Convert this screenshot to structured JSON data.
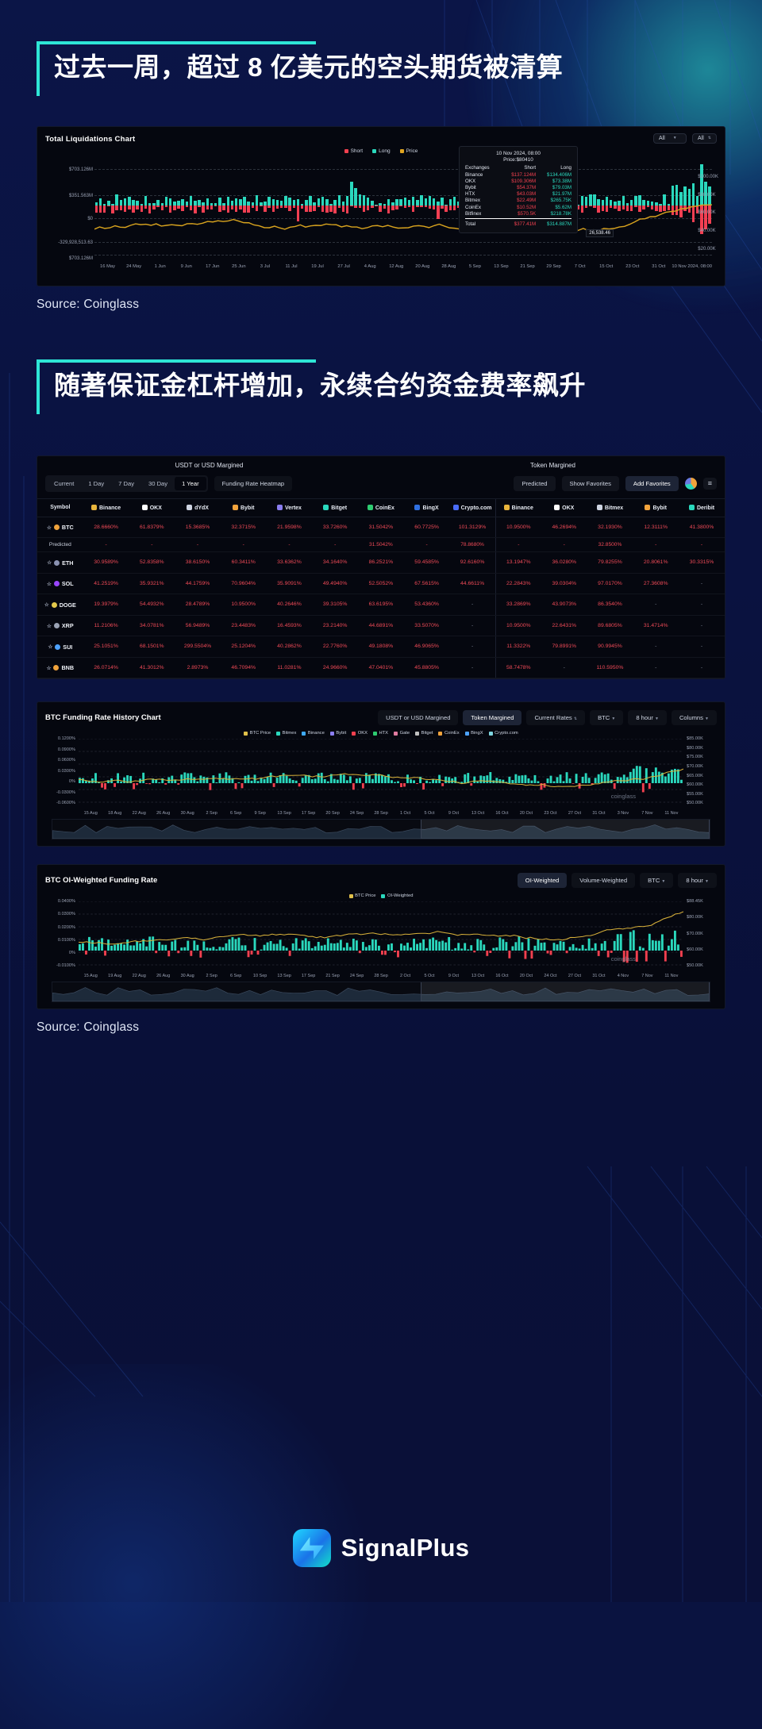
{
  "headline1": "过去一周，超过 8 亿美元的空头期货被清算",
  "headline2": "随著保证金杠杆增加，永续合约资金费率飙升",
  "source1": "Source: Coinglass",
  "source2": "Source: Coinglass",
  "brand": "SignalPlus",
  "liquidations": {
    "title": "Total Liquidations Chart",
    "controls": [
      {
        "label": "All"
      },
      {
        "label": "All"
      }
    ],
    "legend": [
      {
        "label": "Short",
        "color": "#f2404f"
      },
      {
        "label": "Long",
        "color": "#2ad8bd"
      },
      {
        "label": "Price",
        "color": "#e0a420"
      }
    ],
    "y_labels": [
      "$703.126M",
      "$351.563M",
      "$0",
      "-329,928,513.63",
      "$703.126M"
    ],
    "y_right": [
      "$100.00K",
      "$80.00K",
      "$60.00K",
      "$40.00K",
      "$20.00K"
    ],
    "x_labels": [
      "16 May",
      "24 May",
      "1 Jun",
      "9 Jun",
      "17 Jun",
      "25 Jun",
      "3 Jul",
      "11 Jul",
      "19 Jul",
      "27 Jul",
      "4 Aug",
      "12 Aug",
      "20 Aug",
      "28 Aug",
      "5 Sep",
      "13 Sep",
      "21 Sep",
      "29 Sep",
      "7 Oct",
      "15 Oct",
      "23 Oct",
      "31 Oct",
      "10 Nov 2024, 08:00"
    ],
    "tooltip": {
      "date": "10 Nov 2024, 08:00",
      "price": "Price:$80410",
      "headers": [
        "Exchanges",
        "Short",
        "Long"
      ],
      "rows": [
        {
          "exchange": "Binance",
          "short": "$137.124M",
          "long": "$134.406M"
        },
        {
          "exchange": "OKX",
          "short": "$109.306M",
          "long": "$73.38M"
        },
        {
          "exchange": "Bybit",
          "short": "$54.37M",
          "long": "$79.03M"
        },
        {
          "exchange": "HTX",
          "short": "$43.03M",
          "long": "$21.97M"
        },
        {
          "exchange": "Bitmex",
          "short": "$22.49M",
          "long": "$265.75K"
        },
        {
          "exchange": "CoinEx",
          "short": "$10.52M",
          "long": "$5.62M"
        },
        {
          "exchange": "Bitfinex",
          "short": "$570.5K",
          "long": "$218.78K"
        }
      ],
      "total": {
        "exchange": "Total",
        "short": "$377.41M",
        "long": "$314.887M"
      },
      "marker": "26,538.46"
    }
  },
  "heatmap": {
    "group_left": "USDT or USD Margined",
    "group_right": "Token Margined",
    "tabs": [
      "Current",
      "1 Day",
      "7 Day",
      "30 Day",
      "1 Year"
    ],
    "tab_active": "1 Year",
    "heatmap_button": "Funding Rate Heatmap",
    "predicted_button": "Predicted",
    "favorites_button": "Show Favorites",
    "add_favorites_button": "Add Favorites",
    "columns": [
      "Symbol",
      "Binance",
      "OKX",
      "dYdX",
      "Bybit",
      "Vertex",
      "Bitget",
      "CoinEx",
      "BingX",
      "Crypto.com",
      "Binance",
      "OKX",
      "Bitmex",
      "Bybit",
      "Deribit"
    ],
    "rows": [
      {
        "symbol": "BTC",
        "color": "#f0a33c",
        "values": [
          "28.6660%",
          "61.8379%",
          "15.3685%",
          "32.3715%",
          "21.9598%",
          "33.7260%",
          "31.5042%",
          "60.7725%",
          "101.3129%",
          "10.9500%",
          "46.2694%",
          "32.1930%",
          "12.3111%",
          "41.3800%"
        ]
      },
      {
        "symbol": "Predicted",
        "predicted": true,
        "values": [
          "-",
          "-",
          "-",
          "-",
          "-",
          "-",
          "31.5042%",
          "-",
          "78.8680%",
          "-",
          "-",
          "32.8500%",
          "-",
          "-"
        ]
      },
      {
        "symbol": "ETH",
        "color": "#8a92b2",
        "values": [
          "30.9589%",
          "52.8358%",
          "38.6150%",
          "60.3411%",
          "33.6362%",
          "34.1640%",
          "86.2521%",
          "59.4585%",
          "92.6160%",
          "13.1947%",
          "36.0280%",
          "79.8255%",
          "20.8061%",
          "30.3315%"
        ]
      },
      {
        "symbol": "SOL",
        "color": "#9945ff",
        "values": [
          "41.2519%",
          "35.9321%",
          "44.1759%",
          "70.9604%",
          "35.9091%",
          "49.4940%",
          "52.5052%",
          "67.5615%",
          "44.6611%",
          "22.2843%",
          "39.0304%",
          "97.0170%",
          "27.3608%",
          "-"
        ]
      },
      {
        "symbol": "DOGE",
        "color": "#e2c84b",
        "values": [
          "19.3979%",
          "54.4932%",
          "28.4789%",
          "10.9500%",
          "40.2646%",
          "39.3105%",
          "63.6195%",
          "53.4360%",
          "-",
          "33.2869%",
          "43.9073%",
          "86.3540%",
          "-",
          "-"
        ]
      },
      {
        "symbol": "XRP",
        "color": "#9aa2b4",
        "values": [
          "11.2106%",
          "34.0781%",
          "56.9489%",
          "23.4483%",
          "16.4593%",
          "23.2140%",
          "44.6891%",
          "33.5070%",
          "-",
          "10.9500%",
          "22.6431%",
          "89.6805%",
          "31.4714%",
          "-"
        ]
      },
      {
        "symbol": "SUI",
        "color": "#4da2ff",
        "values": [
          "25.1051%",
          "68.1501%",
          "299.5504%",
          "25.1204%",
          "40.2862%",
          "22.7760%",
          "49.1808%",
          "46.9065%",
          "-",
          "11.3322%",
          "79.8991%",
          "90.9945%",
          "-",
          "-"
        ]
      },
      {
        "symbol": "BNB",
        "color": "#f0a33c",
        "values": [
          "26.0714%",
          "41.3012%",
          "2.8973%",
          "46.7094%",
          "11.0281%",
          "24.9660%",
          "47.0401%",
          "45.8805%",
          "-",
          "58.7478%",
          "-",
          "110.5950%",
          "-",
          "-"
        ]
      }
    ]
  },
  "funding_chart": {
    "title": "BTC Funding Rate History Chart",
    "buttons": [
      "USDT or USD Margined",
      "Token Margined",
      "Current Rates",
      "BTC",
      "8 hour",
      "Columns"
    ],
    "active_button": "Token Margined",
    "legend": [
      "BTC Price",
      "Bitmex",
      "Binance",
      "Bybit",
      "OKX",
      "HTX",
      "Gate",
      "Bitget",
      "CoinEx",
      "BingX",
      "Crypto.com"
    ],
    "legend_colors": [
      "#e0c04a",
      "#2ad8bd",
      "#3fa9f5",
      "#8b7ef0",
      "#f2404f",
      "#2ecc71",
      "#e07ba0",
      "#c0c0c0",
      "#f0a33c",
      "#4da2ff",
      "#7fd6e0"
    ],
    "y_left": [
      "0.1200%",
      "0.0900%",
      "0.0600%",
      "0.0300%",
      "0%",
      "-0.0300%",
      "-0.0600%"
    ],
    "y_right": [
      "$85.00K",
      "$80.00K",
      "$75.00K",
      "$70.00K",
      "$65.00K",
      "$60.00K",
      "$55.00K",
      "$50.00K"
    ],
    "x_labels": [
      "15 Aug",
      "18 Aug",
      "22 Aug",
      "26 Aug",
      "30 Aug",
      "2 Sep",
      "6 Sep",
      "9 Sep",
      "13 Sep",
      "17 Sep",
      "20 Sep",
      "24 Sep",
      "28 Sep",
      "1 Oct",
      "5 Oct",
      "9 Oct",
      "13 Oct",
      "16 Oct",
      "20 Oct",
      "23 Oct",
      "27 Oct",
      "31 Oct",
      "3 Nov",
      "7 Nov",
      "11 Nov"
    ],
    "watermark": "coinglass"
  },
  "oi_chart": {
    "title": "BTC OI-Weighted Funding Rate",
    "buttons": [
      "OI-Weighted",
      "Volume-Weighted",
      "BTC",
      "8 hour"
    ],
    "active_button": "OI-Weighted",
    "legend": [
      "BTC Price",
      "OI-Weighted"
    ],
    "legend_colors": [
      "#e0c04a",
      "#2ad8bd"
    ],
    "y_left": [
      "0.0400%",
      "0.0300%",
      "0.0200%",
      "0.0100%",
      "0%",
      "-0.0100%"
    ],
    "y_right": [
      "$88.45K",
      "$80.00K",
      "$70.00K",
      "$60.00K",
      "$50.00K"
    ],
    "x_labels": [
      "15 Aug",
      "19 Aug",
      "22 Aug",
      "26 Aug",
      "30 Aug",
      "2 Sep",
      "6 Sep",
      "10 Sep",
      "13 Sep",
      "17 Sep",
      "21 Sep",
      "24 Sep",
      "28 Sep",
      "2 Oct",
      "5 Oct",
      "9 Oct",
      "13 Oct",
      "16 Oct",
      "20 Oct",
      "24 Oct",
      "27 Oct",
      "31 Oct",
      "4 Nov",
      "7 Nov",
      "11 Nov"
    ],
    "watermark": "coinglass"
  }
}
